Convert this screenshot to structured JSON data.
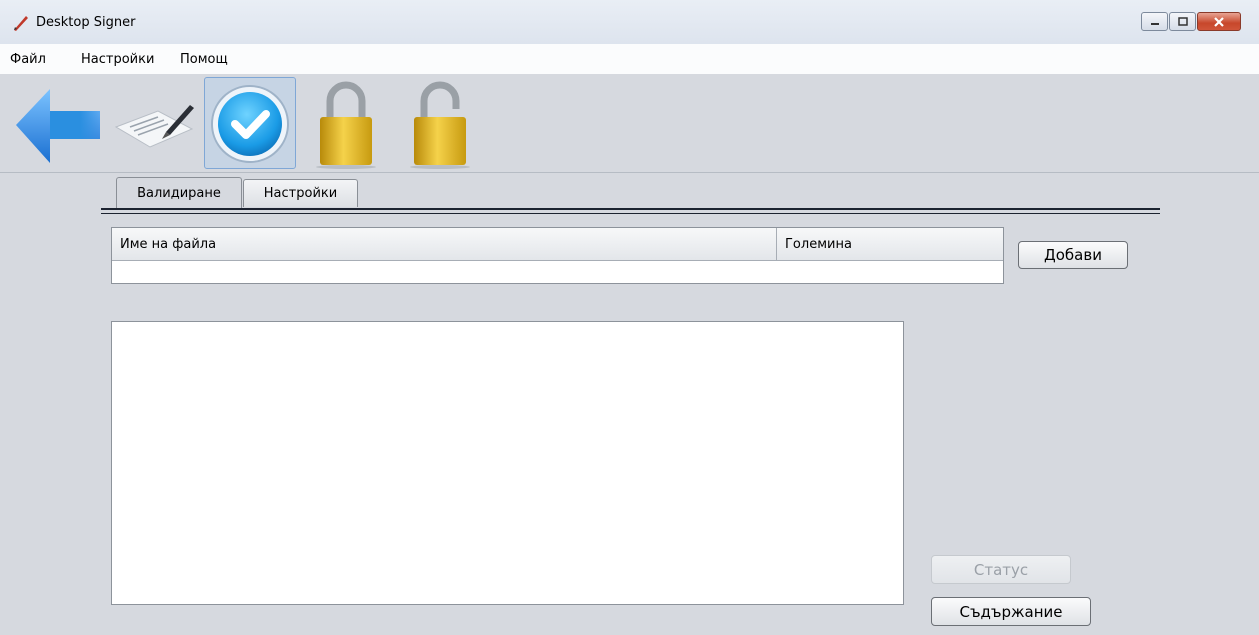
{
  "window": {
    "title": "Desktop Signer",
    "controls": [
      "minimize",
      "maximize",
      "close"
    ]
  },
  "menu": {
    "items": [
      "Файл",
      "Настройки",
      "Помощ"
    ]
  },
  "toolbar": {
    "buttons": [
      {
        "icon": "back-arrow-icon",
        "selected": false
      },
      {
        "icon": "sign-document-icon",
        "selected": false
      },
      {
        "icon": "validate-check-icon",
        "selected": true
      },
      {
        "icon": "lock-closed-icon",
        "selected": false
      },
      {
        "icon": "lock-open-icon",
        "selected": false
      }
    ]
  },
  "tabs": [
    {
      "label": "Валидиране",
      "active": true
    },
    {
      "label": "Настройки",
      "active": false
    }
  ],
  "files_table": {
    "columns": [
      "Име на файла",
      "Големина"
    ],
    "rows": []
  },
  "buttons": {
    "add": "Добави",
    "status": "Статус",
    "content": "Съдържание"
  },
  "output": {
    "text": ""
  },
  "colors": {
    "accent_blue": "#2a8fe0",
    "lock_gold": "#e3b21c",
    "close_red": "#c7472b"
  }
}
